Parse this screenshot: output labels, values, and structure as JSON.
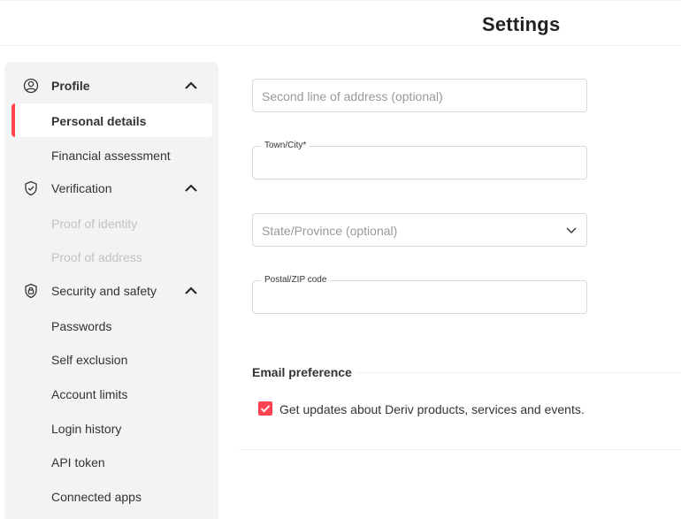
{
  "header": {
    "title": "Settings"
  },
  "sidebar": {
    "sections": [
      {
        "label": "Profile",
        "icon": "user-circle-icon",
        "expanded": true,
        "items": [
          {
            "label": "Personal details",
            "active": true,
            "disabled": false
          },
          {
            "label": "Financial assessment",
            "active": false,
            "disabled": false
          }
        ]
      },
      {
        "label": "Verification",
        "icon": "shield-check-icon",
        "expanded": true,
        "items": [
          {
            "label": "Proof of identity",
            "active": false,
            "disabled": true
          },
          {
            "label": "Proof of address",
            "active": false,
            "disabled": true
          }
        ]
      },
      {
        "label": "Security and safety",
        "icon": "shield-lock-icon",
        "expanded": true,
        "items": [
          {
            "label": "Passwords",
            "active": false,
            "disabled": false
          },
          {
            "label": "Self exclusion",
            "active": false,
            "disabled": false
          },
          {
            "label": "Account limits",
            "active": false,
            "disabled": false
          },
          {
            "label": "Login history",
            "active": false,
            "disabled": false
          },
          {
            "label": "API token",
            "active": false,
            "disabled": false
          },
          {
            "label": "Connected apps",
            "active": false,
            "disabled": false
          }
        ]
      }
    ]
  },
  "form": {
    "address_line_2": {
      "placeholder": "Second line of address (optional)",
      "value": ""
    },
    "town_city": {
      "label": "Town/City*",
      "value": ""
    },
    "state_province": {
      "placeholder": "State/Province (optional)",
      "value": ""
    },
    "postal_code": {
      "label": "Postal/ZIP code",
      "value": ""
    }
  },
  "email_preference": {
    "title": "Email preference",
    "checkbox_label": "Get updates about Deriv products, services and events.",
    "checked": true
  },
  "colors": {
    "accent": "#ff444f",
    "sidebar_bg": "#f2f3f4",
    "disabled_text": "#c2c2c2"
  }
}
